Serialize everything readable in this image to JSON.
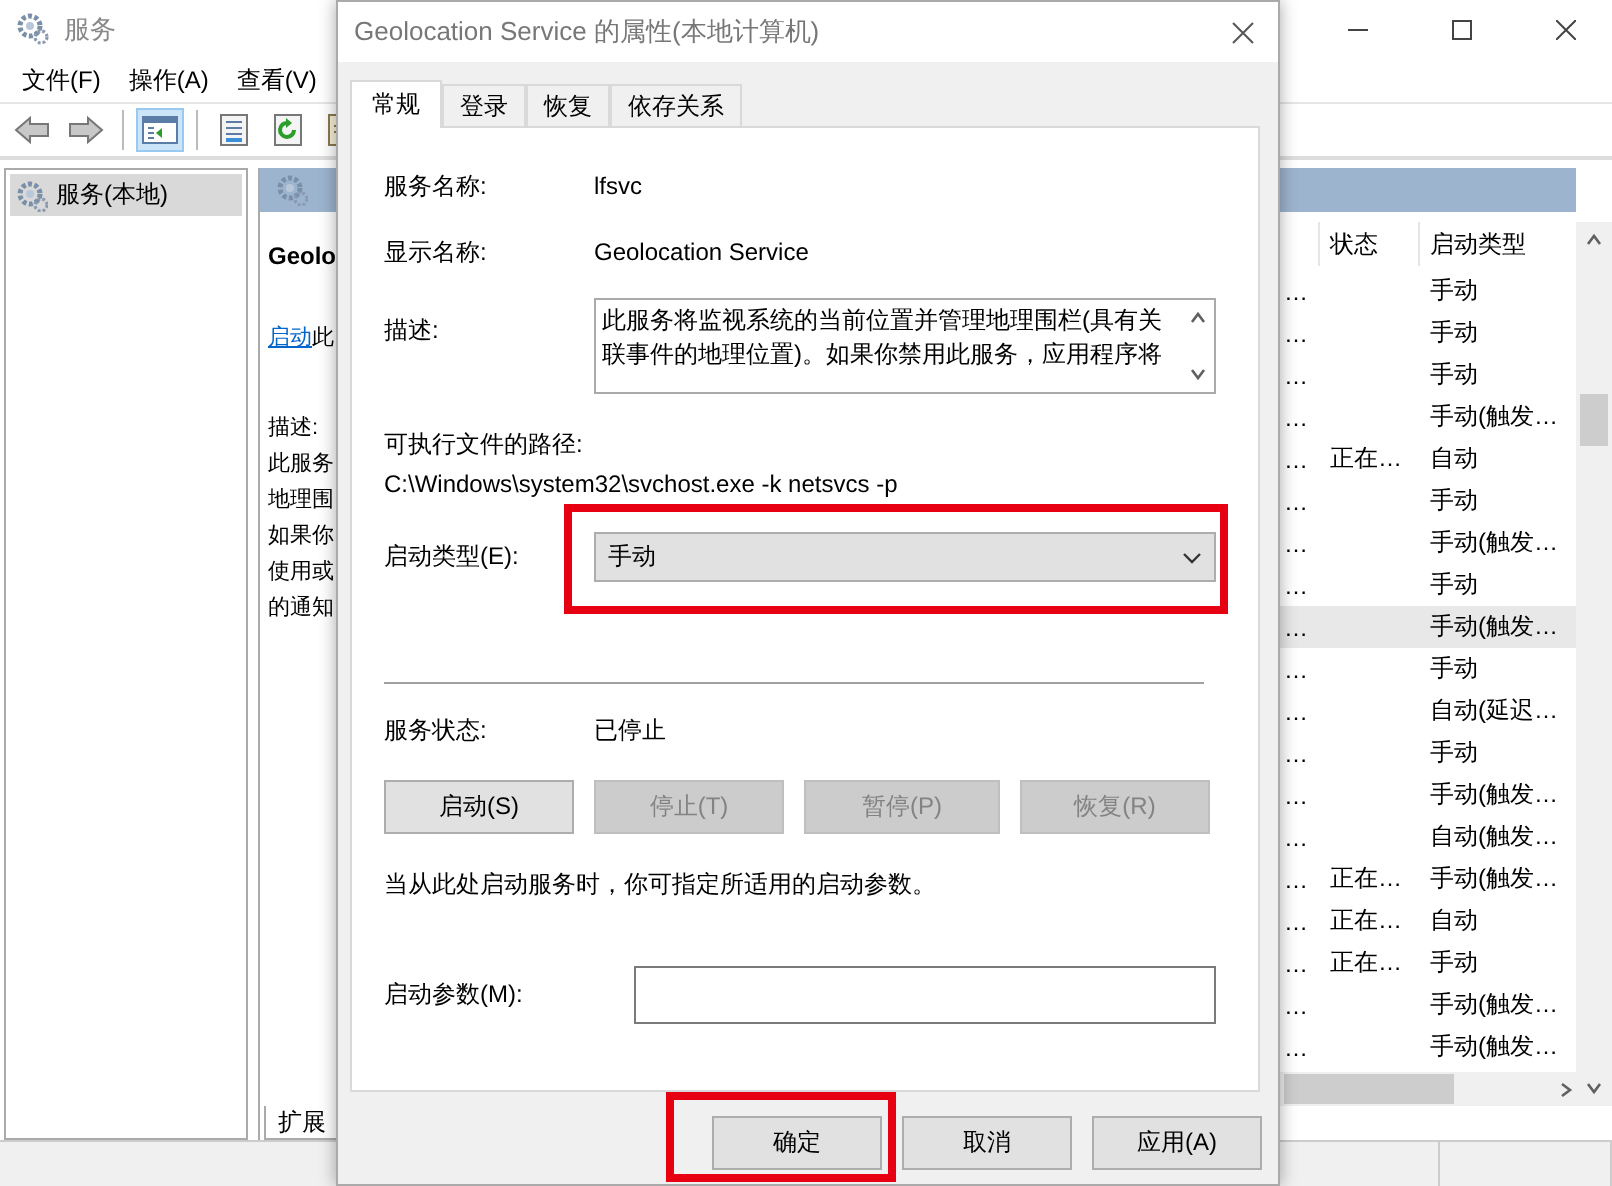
{
  "window": {
    "title": "服务",
    "menu": [
      "文件(F)",
      "操作(A)",
      "查看(V)"
    ],
    "toolbar": [
      {
        "kind": "back",
        "pressed": false
      },
      {
        "kind": "forward",
        "pressed": false
      },
      {
        "kind": "pane",
        "pressed": true
      },
      {
        "kind": "properties",
        "pressed": false
      },
      {
        "kind": "refresh",
        "pressed": false
      },
      {
        "kind": "export",
        "pressed": false
      }
    ],
    "tree": [
      {
        "label": "服务(本地)",
        "selected": true
      }
    ],
    "detail": {
      "heading": "Geolo",
      "link": "启动",
      "link_tail": "此",
      "description_label": "描述:",
      "description_lines": [
        "此服务",
        "地理围",
        "如果你",
        "使用或",
        "的通知"
      ]
    },
    "list": {
      "columns": [
        "状态",
        "启动类型"
      ],
      "rows": [
        {
          "column_1": "…",
          "startup": "手动",
          "selected": false
        },
        {
          "column_1": "…",
          "startup": "手动",
          "selected": false
        },
        {
          "column_1": "…",
          "startup": "手动",
          "selected": false
        },
        {
          "column_1": "…",
          "startup": "手动(触发…",
          "selected": false
        },
        {
          "column_1": "…",
          "status": "正在…",
          "startup": "自动",
          "selected": false
        },
        {
          "column_1": "…",
          "startup": "手动",
          "selected": false
        },
        {
          "column_1": "…",
          "startup": "手动(触发…",
          "selected": false
        },
        {
          "column_1": "…",
          "startup": "手动",
          "selected": false
        },
        {
          "column_1": "…",
          "startup": "手动(触发…",
          "selected": true
        },
        {
          "column_1": "…",
          "startup": "手动",
          "selected": false
        },
        {
          "column_1": "…",
          "startup": "自动(延迟…",
          "selected": false
        },
        {
          "column_1": "…",
          "startup": "手动",
          "selected": false
        },
        {
          "column_1": "…",
          "startup": "手动(触发…",
          "selected": false
        },
        {
          "column_1": "…",
          "startup": "自动(触发…",
          "selected": false
        },
        {
          "column_1": "…",
          "status": "正在…",
          "startup": "手动(触发…",
          "selected": false
        },
        {
          "column_1": "…",
          "status": "正在…",
          "startup": "自动",
          "selected": false
        },
        {
          "column_1": "…",
          "status": "正在…",
          "startup": "手动",
          "selected": false
        },
        {
          "column_1": "…",
          "startup": "手动(触发…",
          "selected": false
        },
        {
          "column_1": "…",
          "startup": "手动(触发…",
          "selected": false
        }
      ]
    },
    "bottom_tabs": [
      {
        "label": "扩展",
        "selected": true
      }
    ]
  },
  "dialog": {
    "title": "Geolocation Service 的属性(本地计算机)",
    "tabs": [
      {
        "label": "常规",
        "selected": true
      },
      {
        "label": "登录",
        "selected": false
      },
      {
        "label": "恢复",
        "selected": false
      },
      {
        "label": "依存关系",
        "selected": false
      }
    ],
    "service_name": {
      "label": "服务名称:",
      "value": "lfsvc"
    },
    "display_name": {
      "label": "显示名称:",
      "value": "Geolocation Service"
    },
    "description": {
      "label": "描述:",
      "lines": [
        "此服务将监视系统的当前位置并管理地理围栏(具有关",
        "联事件的地理位置)。如果你禁用此服务，应用程序将"
      ]
    },
    "path": {
      "label": "可执行文件的路径:",
      "value": "C:\\Windows\\system32\\svchost.exe -k netsvcs -p"
    },
    "startup_type": {
      "label": "启动类型(E):",
      "value": "手动",
      "highlighted": true
    },
    "service_status": {
      "label": "服务状态:",
      "value": "已停止"
    },
    "service_buttons": [
      {
        "label": "启动(S)",
        "disabled": false
      },
      {
        "label": "停止(T)",
        "disabled": true
      },
      {
        "label": "暂停(P)",
        "disabled": true
      },
      {
        "label": "恢复(R)",
        "disabled": true
      }
    ],
    "hint": "当从此处启动服务时，你可指定所适用的启动参数。",
    "start_parameters": {
      "label": "启动参数(M):"
    },
    "buttons": [
      {
        "label": "确定",
        "highlighted": true
      },
      {
        "label": "取消",
        "highlighted": false
      },
      {
        "label": "应用(A)",
        "highlighted": false
      }
    ]
  }
}
